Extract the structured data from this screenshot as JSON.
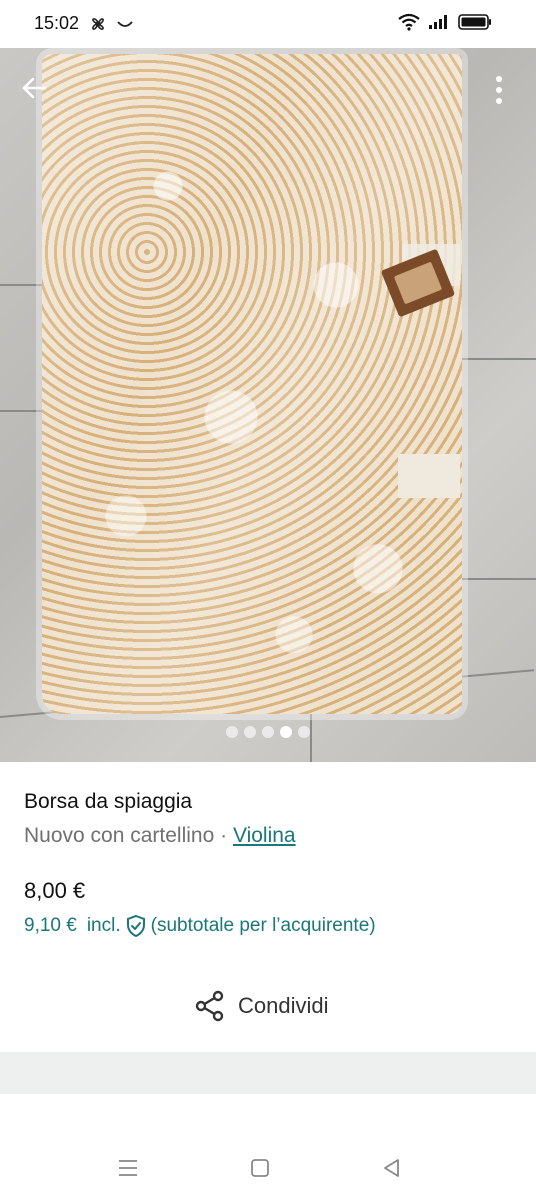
{
  "status_bar": {
    "time": "15:02",
    "icons_left": [
      "fan-icon",
      "smile-icon"
    ],
    "icons_right": [
      "wifi-icon",
      "signal-icon",
      "battery-icon"
    ]
  },
  "toolbar": {
    "back_icon": "arrow-left-icon",
    "more_icon": "more-vertical-icon"
  },
  "gallery": {
    "photo_count": 5,
    "active_index": 3
  },
  "item": {
    "title": "Borsa da spiaggia",
    "condition": "Nuovo con cartellino · ",
    "brand": "Violina",
    "price": "8,00 €",
    "buyer_price": "9,10 €",
    "buyer_price_incl": "incl.",
    "buyer_price_note": "(subtotale per l’acquirente)"
  },
  "share": {
    "label": "Condividi",
    "icon": "share-icon"
  },
  "nav_bar": {
    "icons": [
      "menu-icon",
      "home-square-icon",
      "back-triangle-icon"
    ]
  },
  "colors": {
    "accent": "#1b7778",
    "text_secondary": "#707070"
  }
}
